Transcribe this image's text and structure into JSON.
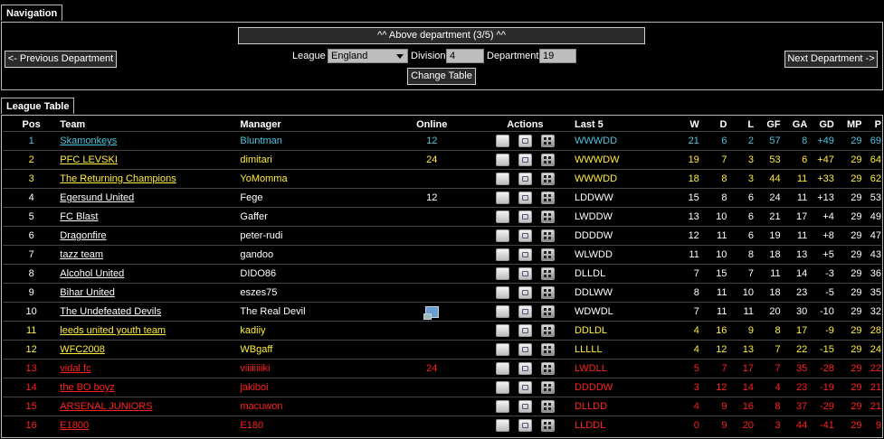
{
  "navigation": {
    "tab_label": "Navigation",
    "above_department": "^^ Above department  (3/5) ^^",
    "prev_department": "<- Previous Department",
    "next_department": "Next Department ->",
    "league_label": "League",
    "league_value": "England",
    "division_label": "Division",
    "division_value": "4",
    "department_label": "Department",
    "department_value": "19",
    "change_table": "Change Table"
  },
  "league_table": {
    "tab_label": "League Table",
    "headers": {
      "pos": "Pos",
      "team": "Team",
      "manager": "Manager",
      "online": "Online",
      "actions": "Actions",
      "last5": "Last 5",
      "w": "W",
      "d": "D",
      "l": "L",
      "gf": "GF",
      "ga": "GA",
      "gd": "GD",
      "mp": "MP",
      "p": "P"
    },
    "colors": {
      "promotion": "#4ec4e0",
      "playoff": "#ffee3a",
      "normal": "#ffffff",
      "relegation": "#ff2020"
    },
    "rows": [
      {
        "pos": "1",
        "team": "Skamonkeys",
        "manager": "Bluntman",
        "online": "12",
        "online_icon": false,
        "last5": "WWWDD",
        "w": "21",
        "d": "6",
        "l": "2",
        "gf": "57",
        "ga": "8",
        "gd": "+49",
        "mp": "29",
        "p": "69",
        "zone": "promotion"
      },
      {
        "pos": "2",
        "team": "PFC LEVSKI",
        "manager": "dimitari",
        "online": "24",
        "online_icon": false,
        "last5": "WWWDW",
        "w": "19",
        "d": "7",
        "l": "3",
        "gf": "53",
        "ga": "6",
        "gd": "+47",
        "mp": "29",
        "p": "64",
        "zone": "playoff"
      },
      {
        "pos": "3",
        "team": "The Returning Champions",
        "manager": "YoMomma",
        "online": "",
        "online_icon": false,
        "last5": "WWWDD",
        "w": "18",
        "d": "8",
        "l": "3",
        "gf": "44",
        "ga": "11",
        "gd": "+33",
        "mp": "29",
        "p": "62",
        "zone": "playoff"
      },
      {
        "pos": "4",
        "team": "Egersund United",
        "manager": "Fege",
        "online": "12",
        "online_icon": false,
        "last5": "LDDWW",
        "w": "15",
        "d": "8",
        "l": "6",
        "gf": "24",
        "ga": "11",
        "gd": "+13",
        "mp": "29",
        "p": "53",
        "zone": "normal"
      },
      {
        "pos": "5",
        "team": "FC Blast",
        "manager": "Gaffer",
        "online": "",
        "online_icon": false,
        "last5": "LWDDW",
        "w": "13",
        "d": "10",
        "l": "6",
        "gf": "21",
        "ga": "17",
        "gd": "+4",
        "mp": "29",
        "p": "49",
        "zone": "normal"
      },
      {
        "pos": "6",
        "team": "Dragonfire",
        "manager": "peter-rudi",
        "online": "",
        "online_icon": false,
        "last5": "DDDDW",
        "w": "12",
        "d": "11",
        "l": "6",
        "gf": "19",
        "ga": "11",
        "gd": "+8",
        "mp": "29",
        "p": "47",
        "zone": "normal"
      },
      {
        "pos": "7",
        "team": "tazz team",
        "manager": "gandoo",
        "online": "",
        "online_icon": false,
        "last5": "WLWDD",
        "w": "11",
        "d": "10",
        "l": "8",
        "gf": "18",
        "ga": "13",
        "gd": "+5",
        "mp": "29",
        "p": "43",
        "zone": "normal"
      },
      {
        "pos": "8",
        "team": "Alcohol United",
        "manager": "DIDO86",
        "online": "",
        "online_icon": false,
        "last5": "DLLDL",
        "w": "7",
        "d": "15",
        "l": "7",
        "gf": "11",
        "ga": "14",
        "gd": "-3",
        "mp": "29",
        "p": "36",
        "zone": "normal"
      },
      {
        "pos": "9",
        "team": "Bihar United",
        "manager": "eszes75",
        "online": "",
        "online_icon": false,
        "last5": "DDLWW",
        "w": "8",
        "d": "11",
        "l": "10",
        "gf": "18",
        "ga": "23",
        "gd": "-5",
        "mp": "29",
        "p": "35",
        "zone": "normal"
      },
      {
        "pos": "10",
        "team": "The Undefeated Devils",
        "manager": "The Real Devil",
        "online": "",
        "online_icon": true,
        "last5": "WDWDL",
        "w": "7",
        "d": "11",
        "l": "11",
        "gf": "20",
        "ga": "30",
        "gd": "-10",
        "mp": "29",
        "p": "32",
        "zone": "normal"
      },
      {
        "pos": "11",
        "team": "leeds united youth team",
        "manager": "kadiiy",
        "online": "",
        "online_icon": false,
        "last5": "DDLDL",
        "w": "4",
        "d": "16",
        "l": "9",
        "gf": "8",
        "ga": "17",
        "gd": "-9",
        "mp": "29",
        "p": "28",
        "zone": "playoff"
      },
      {
        "pos": "12",
        "team": "WFC2008",
        "manager": "WBgaff",
        "online": "",
        "online_icon": false,
        "last5": "LLLLL",
        "w": "4",
        "d": "12",
        "l": "13",
        "gf": "7",
        "ga": "22",
        "gd": "-15",
        "mp": "29",
        "p": "24",
        "zone": "playoff"
      },
      {
        "pos": "13",
        "team": "vidal fc",
        "manager": "viiiiiiiiki",
        "online": "24",
        "online_icon": false,
        "last5": "LWDLL",
        "w": "5",
        "d": "7",
        "l": "17",
        "gf": "7",
        "ga": "35",
        "gd": "-28",
        "mp": "29",
        "p": "22",
        "zone": "relegation"
      },
      {
        "pos": "14",
        "team": "the BO boyz",
        "manager": "jakiboi",
        "online": "",
        "online_icon": false,
        "last5": "DDDDW",
        "w": "3",
        "d": "12",
        "l": "14",
        "gf": "4",
        "ga": "23",
        "gd": "-19",
        "mp": "29",
        "p": "21",
        "zone": "relegation"
      },
      {
        "pos": "15",
        "team": "ARSENAL JUNIORS",
        "manager": "macuwon",
        "online": "",
        "online_icon": false,
        "last5": "DLLDD",
        "w": "4",
        "d": "9",
        "l": "16",
        "gf": "8",
        "ga": "37",
        "gd": "-29",
        "mp": "29",
        "p": "21",
        "zone": "relegation"
      },
      {
        "pos": "16",
        "team": "E1800",
        "manager": "E180",
        "online": "",
        "online_icon": false,
        "last5": "LLDDL",
        "w": "0",
        "d": "9",
        "l": "20",
        "gf": "3",
        "ga": "44",
        "gd": "-41",
        "mp": "29",
        "p": "9",
        "zone": "relegation"
      }
    ]
  }
}
